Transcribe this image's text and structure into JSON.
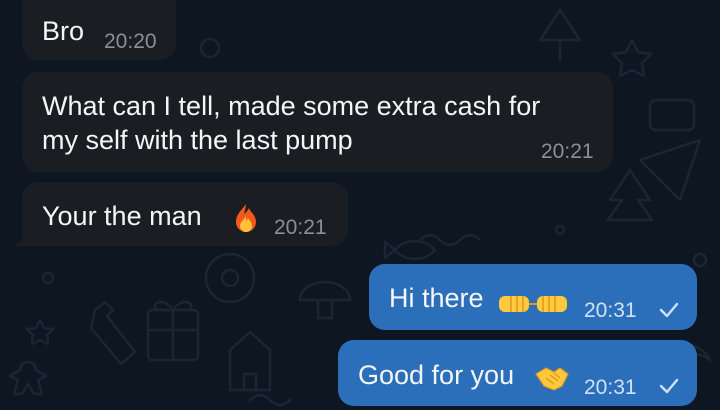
{
  "chat": {
    "messages": [
      {
        "direction": "incoming",
        "text": "Bro",
        "time": "20:20"
      },
      {
        "direction": "incoming",
        "text_line1": "What can I tell, made some extra cash for",
        "text_line2": "my self with the last pump",
        "time": "20:21"
      },
      {
        "direction": "incoming",
        "text": "Your the man",
        "emoji": "fire-emoji",
        "time": "20:21"
      },
      {
        "direction": "outgoing",
        "text": "Hi there",
        "emoji": "fist-bump-emoji",
        "time": "20:31",
        "status": "sent-check-icon"
      },
      {
        "direction": "outgoing",
        "text": "Good for you",
        "emoji": "handshake-emoji",
        "time": "20:31",
        "status": "sent-check-icon"
      }
    ]
  },
  "colors": {
    "background": "#0e1621",
    "incoming_bubble": "#1a1d22",
    "outgoing_bubble": "#2b6fba",
    "timestamp_incoming": "#8a9098",
    "timestamp_outgoing": "#cfe2f6"
  }
}
